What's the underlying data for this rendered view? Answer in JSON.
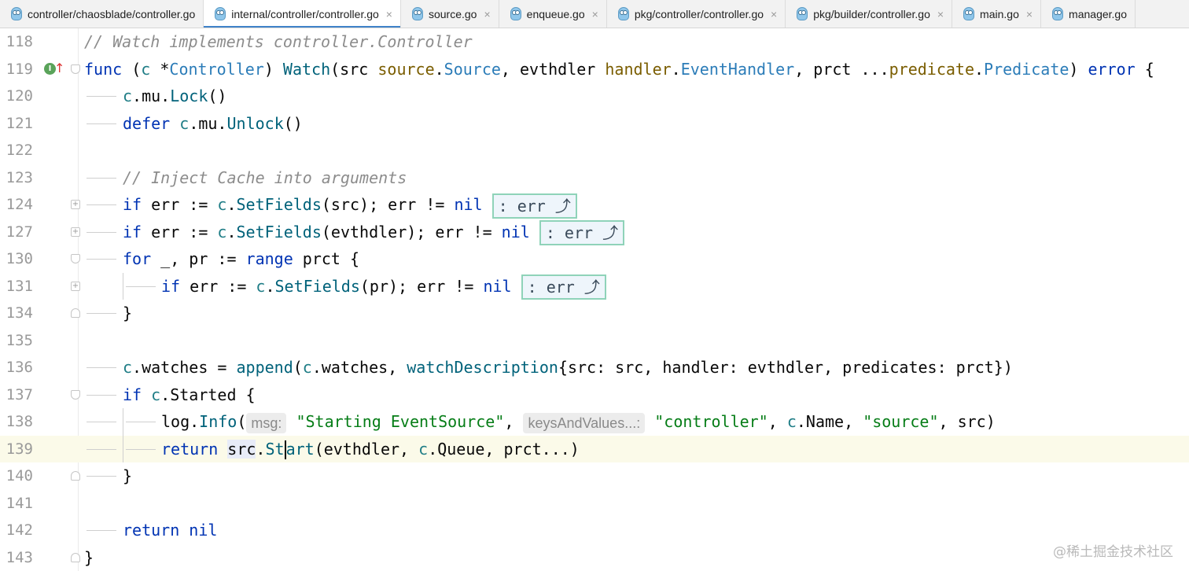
{
  "tabs": [
    {
      "label": "controller/chaosblade/controller.go",
      "active": false,
      "closable": false
    },
    {
      "label": "internal/controller/controller.go",
      "active": true,
      "closable": true
    },
    {
      "label": "source.go",
      "active": false,
      "closable": true
    },
    {
      "label": "enqueue.go",
      "active": false,
      "closable": true
    },
    {
      "label": "pkg/controller/controller.go",
      "active": false,
      "closable": true
    },
    {
      "label": "pkg/builder/controller.go",
      "active": false,
      "closable": true
    },
    {
      "label": "main.go",
      "active": false,
      "closable": true
    },
    {
      "label": "manager.go",
      "active": false,
      "closable": false
    }
  ],
  "close_glyph": "×",
  "gutter_marker": {
    "letter": "I",
    "arrow": "↑"
  },
  "lines": [
    {
      "n": "118",
      "c": "// Watch implements controller.Controller"
    },
    {
      "n": "119",
      "c": "func (c *Controller) Watch(src source.Source, evthdler handler.EventHandler, prct ...predicate.Predicate) error {"
    },
    {
      "n": "120",
      "c": "c.mu.Lock()"
    },
    {
      "n": "121",
      "c": "defer c.mu.Unlock()"
    },
    {
      "n": "122",
      "c": ""
    },
    {
      "n": "123",
      "c": "// Inject Cache into arguments"
    },
    {
      "n": "124",
      "c": "if err := c.SetFields(src); err != nil",
      "folded": ": err ⤴"
    },
    {
      "n": "127",
      "c": "if err := c.SetFields(evthdler); err != nil",
      "folded": ": err ⤴"
    },
    {
      "n": "130",
      "c": "for _, pr := range prct {"
    },
    {
      "n": "131",
      "c": "if err := c.SetFields(pr); err != nil",
      "folded": ": err ⤴"
    },
    {
      "n": "134",
      "c": "}"
    },
    {
      "n": "135",
      "c": ""
    },
    {
      "n": "136",
      "c": "c.watches = append(c.watches, watchDescription{src: src, handler: evthdler, predicates: prct})"
    },
    {
      "n": "137",
      "c": "if c.Started {"
    },
    {
      "n": "138",
      "c": "log.Info(msg: \"Starting EventSource\", keysAndValues...: \"controller\", c.Name, \"source\", src)",
      "hints": [
        "msg:",
        "keysAndValues...:"
      ]
    },
    {
      "n": "139",
      "c": "return src.Start(evthdler, c.Queue, prct...)"
    },
    {
      "n": "140",
      "c": "}"
    },
    {
      "n": "141",
      "c": ""
    },
    {
      "n": "142",
      "c": "return nil"
    },
    {
      "n": "143",
      "c": "}"
    }
  ],
  "watermark": "@稀土掘金技术社区",
  "colors": {
    "keyword": "#0033b3",
    "function": "#00627a",
    "type": "#7a5d00",
    "string": "#067d17",
    "comment": "#8c8c8c",
    "tab_accent": "#4083c9",
    "fold_box_border": "#8fd3b9"
  }
}
